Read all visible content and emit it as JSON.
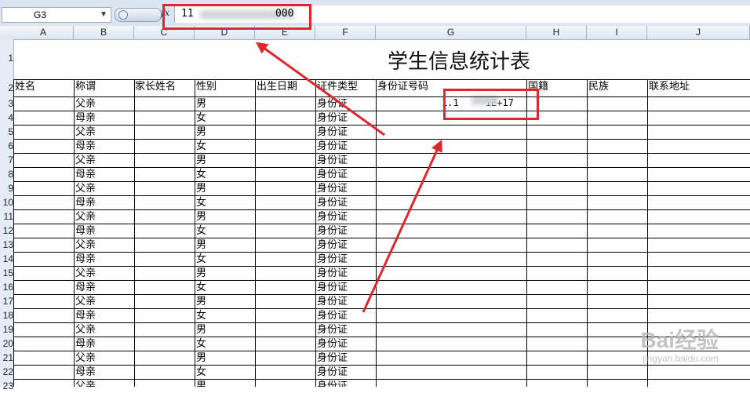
{
  "formula_bar": {
    "name_box": "G3",
    "fx_label": "fx",
    "value_prefix": "11",
    "value_suffix": "000"
  },
  "columns": [
    "A",
    "B",
    "C",
    "D",
    "E",
    "F",
    "G",
    "H",
    "I",
    "J"
  ],
  "row_numbers": [
    "1",
    "2",
    "3",
    "4",
    "5",
    "6",
    "7",
    "8",
    "9",
    "10",
    "11",
    "12",
    "13",
    "14",
    "15",
    "16",
    "17",
    "18",
    "19",
    "20",
    "21",
    "22",
    "23"
  ],
  "title": "学生信息统计表",
  "headers": {
    "name": "姓名",
    "relation": "称谓",
    "parent_name": "家长姓名",
    "gender": "性别",
    "birth_date": "出生日期",
    "id_type": "证件类型",
    "id_number": "身份证号码",
    "nationality": "国籍",
    "ethnicity": "民族",
    "address": "联系地址"
  },
  "rows": [
    {
      "relation": "父亲",
      "gender": "男",
      "id_type": "身份证"
    },
    {
      "relation": "母亲",
      "gender": "女",
      "id_type": "身份证"
    },
    {
      "relation": "父亲",
      "gender": "男",
      "id_type": "身份证"
    },
    {
      "relation": "母亲",
      "gender": "女",
      "id_type": "身份证"
    },
    {
      "relation": "父亲",
      "gender": "男",
      "id_type": "身份证"
    },
    {
      "relation": "母亲",
      "gender": "女",
      "id_type": "身份证"
    },
    {
      "relation": "父亲",
      "gender": "男",
      "id_type": "身份证"
    },
    {
      "relation": "母亲",
      "gender": "女",
      "id_type": "身份证"
    },
    {
      "relation": "父亲",
      "gender": "男",
      "id_type": "身份证"
    },
    {
      "relation": "母亲",
      "gender": "女",
      "id_type": "身份证"
    },
    {
      "relation": "父亲",
      "gender": "男",
      "id_type": "身份证"
    },
    {
      "relation": "母亲",
      "gender": "女",
      "id_type": "身份证"
    },
    {
      "relation": "父亲",
      "gender": "男",
      "id_type": "身份证"
    },
    {
      "relation": "母亲",
      "gender": "女",
      "id_type": "身份证"
    },
    {
      "relation": "父亲",
      "gender": "男",
      "id_type": "身份证"
    },
    {
      "relation": "母亲",
      "gender": "女",
      "id_type": "身份证"
    },
    {
      "relation": "父亲",
      "gender": "男",
      "id_type": "身份证"
    },
    {
      "relation": "母亲",
      "gender": "女",
      "id_type": "身份证"
    },
    {
      "relation": "父亲",
      "gender": "男",
      "id_type": "身份证"
    },
    {
      "relation": "母亲",
      "gender": "女",
      "id_type": "身份证"
    },
    {
      "relation": "父亲",
      "gender": "男",
      "id_type": "身份证"
    }
  ],
  "g3_display": {
    "prefix": "1.1",
    "suffix": "1E+17"
  },
  "watermark": {
    "logo": "Bai经验",
    "url": "jingyan.baidu.com"
  },
  "colors": {
    "annotation_red": "#e0262d",
    "header_bg": "#dbe5f1"
  }
}
